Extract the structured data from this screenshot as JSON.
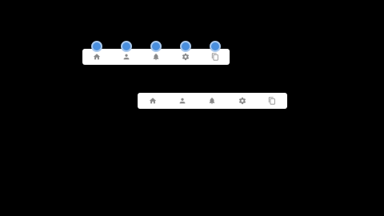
{
  "colors": {
    "background": "#000000",
    "bar_background": "#ffffff",
    "icon": "#8a8a8a",
    "marker": "#4a8fde",
    "marker_ring": "#a9c9ee"
  },
  "tabbars": [
    {
      "id": "top",
      "tabs": [
        {
          "icon": "home-icon",
          "marked": true
        },
        {
          "icon": "person-icon",
          "marked": true
        },
        {
          "icon": "bell-icon",
          "marked": true
        },
        {
          "icon": "gear-icon",
          "marked": true
        },
        {
          "icon": "copy-icon",
          "marked": true
        }
      ]
    },
    {
      "id": "bottom",
      "tabs": [
        {
          "icon": "home-icon",
          "marked": false
        },
        {
          "icon": "person-icon",
          "marked": false
        },
        {
          "icon": "bell-icon",
          "marked": false
        },
        {
          "icon": "gear-icon",
          "marked": false
        },
        {
          "icon": "copy-icon",
          "marked": false
        }
      ]
    }
  ]
}
